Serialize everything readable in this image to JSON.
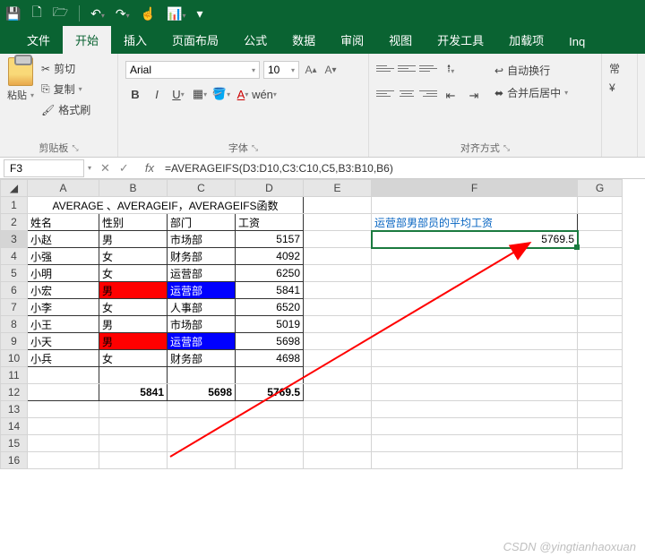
{
  "titlebar_icons": [
    "save-icon",
    "new-icon",
    "open-icon",
    "undo-icon",
    "redo-icon",
    "touch-icon",
    "chart-icon"
  ],
  "tabs": [
    "文件",
    "开始",
    "插入",
    "页面布局",
    "公式",
    "数据",
    "审阅",
    "视图",
    "开发工具",
    "加载项",
    "Inq"
  ],
  "active_tab": "开始",
  "ribbon": {
    "clipboard": {
      "paste": "粘贴",
      "cut": "剪切",
      "copy": "复制",
      "format_painter": "格式刷",
      "title": "剪贴板"
    },
    "font": {
      "name": "Arial",
      "size": "10",
      "title": "字体"
    },
    "align": {
      "wrap": "自动换行",
      "merge": "合并后居中",
      "title": "对齐方式"
    }
  },
  "namebox": "F3",
  "formula": "=AVERAGEIFS(D3:D10,C3:C10,C5,B3:B10,B6)",
  "columns": [
    "A",
    "B",
    "C",
    "D",
    "E",
    "F",
    "G"
  ],
  "rows": [
    1,
    2,
    3,
    4,
    5,
    6,
    7,
    8,
    9,
    10,
    11,
    12,
    13,
    14,
    15,
    16
  ],
  "cells": {
    "A1_merge": "AVERAGE 、AVERAGEIF，AVERAGEIFS函数",
    "A2": "姓名",
    "B2": "性别",
    "C2": "部门",
    "D2": "工资",
    "F2": "运营部男部员的平均工资",
    "A3": "小赵",
    "B3": "男",
    "C3": "市场部",
    "D3": "5157",
    "F3": "5769.5",
    "A4": "小强",
    "B4": "女",
    "C4": "财务部",
    "D4": "4092",
    "A5": "小明",
    "B5": "女",
    "C5": "运营部",
    "D5": "6250",
    "A6": "小宏",
    "B6": "男",
    "C6": "运营部",
    "D6": "5841",
    "A7": "小李",
    "B7": "女",
    "C7": "人事部",
    "D7": "6520",
    "A8": "小王",
    "B8": "男",
    "C8": "市场部",
    "D8": "5019",
    "A9": "小天",
    "B9": "男",
    "C9": "运营部",
    "D9": "5698",
    "A10": "小兵",
    "B10": "女",
    "C10": "财务部",
    "D10": "4698",
    "B12": "5841",
    "C12": "5698",
    "D12": "5769.5"
  },
  "watermark": "CSDN @yingtianhaoxuan"
}
